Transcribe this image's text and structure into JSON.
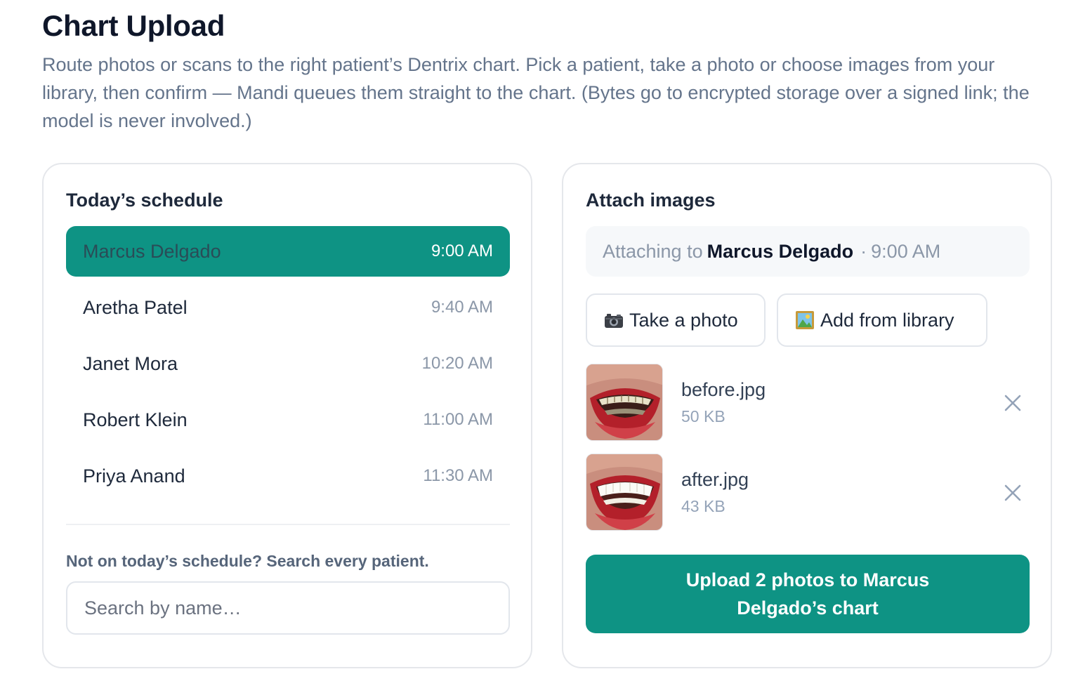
{
  "page": {
    "title": "Chart Upload",
    "description": "Route photos or scans to the right patient’s Dentrix chart. Pick a patient, take a photo or choose images from your library, then confirm — Mandi queues them straight to the chart. (Bytes go to encrypted storage over a signed link; the model is never involved.)"
  },
  "schedule": {
    "title": "Today’s schedule",
    "patients": [
      {
        "name": "Marcus Delgado",
        "time": "9:00 AM",
        "selected": true
      },
      {
        "name": "Aretha Patel",
        "time": "9:40 AM",
        "selected": false
      },
      {
        "name": "Janet Mora",
        "time": "10:20 AM",
        "selected": false
      },
      {
        "name": "Robert Klein",
        "time": "11:00 AM",
        "selected": false
      },
      {
        "name": "Priya Anand",
        "time": "11:30 AM",
        "selected": false
      }
    ],
    "search_hint": "Not on today’s schedule? Search every patient.",
    "search_placeholder": "Search by name…",
    "search_value": ""
  },
  "attach": {
    "title": "Attach images",
    "attaching_prefix": "Attaching to",
    "patient_name": "Marcus Delgado",
    "separator": "·",
    "patient_time": "9:00 AM",
    "take_photo_icon": "camera-icon",
    "take_photo_label": "Take a photo",
    "library_icon": "picture-icon",
    "library_label": "Add from library",
    "files": [
      {
        "name": "before.jpg",
        "size": "50 KB",
        "thumbnail": "smile-before-photo"
      },
      {
        "name": "after.jpg",
        "size": "43 KB",
        "thumbnail": "smile-after-photo"
      }
    ],
    "remove_icon": "close-icon",
    "upload_label": "Upload 2 photos to Marcus Delgado’s chart"
  },
  "colors": {
    "accent": "#0e9384",
    "muted_text": "#64748b",
    "border": "#e5e7eb",
    "selected_name": "#2a4c57"
  }
}
